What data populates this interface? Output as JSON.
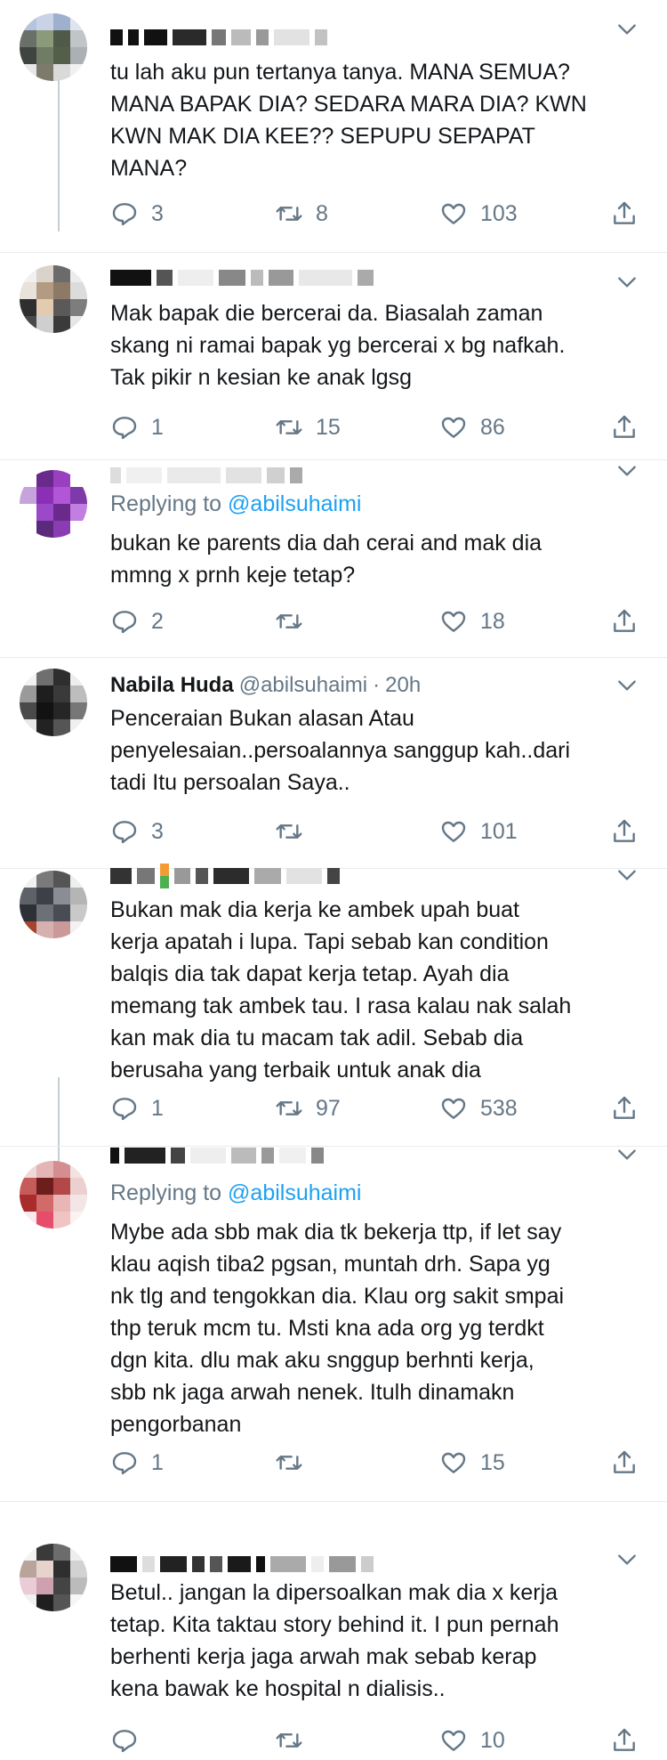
{
  "colors": {
    "text": "#14171a",
    "muted": "#657786",
    "link": "#1da1f2",
    "divider": "#e6ecf0",
    "thread": "#c4cfd6"
  },
  "icons": {
    "reply": "reply-icon",
    "retweet": "retweet-icon",
    "like": "heart-icon",
    "share": "share-icon",
    "more": "chevron-down-icon"
  },
  "tweets": [
    {
      "text": "tu lah aku pun tertanya tanya. MANA SEMUA?\nMANA BAPAK DIA? SEDARA MARA DIA? KWN\nKWN MAK DIA KEE?? SEPUPU SEPAPAT\nMANA?",
      "replies": "3",
      "retweets": "8",
      "likes": "103"
    },
    {
      "text": "Mak bapak die bercerai da. Biasalah zaman\nskang ni ramai bapak yg bercerai x bg nafkah.\nTak pikir n kesian ke anak lgsg",
      "replies": "1",
      "retweets": "15",
      "likes": "86"
    },
    {
      "replying_prefix": "Replying to ",
      "replying_handle": "@abilsuhaimi",
      "text": "bukan ke parents dia dah cerai and mak dia\nmmng x prnh keje tetap?",
      "replies": "2",
      "retweets": "",
      "likes": "18"
    },
    {
      "name": "Nabila Huda",
      "handle": "@abilsuhaimi",
      "sep": "·",
      "time": "20h",
      "text": "Penceraian Bukan alasan Atau\npenyelesaian..persoalannya sanggup kah..dari\ntadi Itu persoalan Saya..",
      "replies": "3",
      "retweets": "",
      "likes": "101"
    },
    {
      "text": "Bukan mak dia kerja ke ambek upah buat\nkerja apatah i lupa. Tapi sebab kan condition\nbalqis dia tak dapat kerja tetap. Ayah dia\nmemang tak ambek tau. I rasa kalau nak salah\nkan mak dia tu macam tak adil. Sebab dia\nberusaha yang terbaik untuk anak dia",
      "replies": "1",
      "retweets": "97",
      "likes": "538"
    },
    {
      "replying_prefix": "Replying to ",
      "replying_handle": "@abilsuhaimi",
      "text": "Mybe ada sbb mak dia tk bekerja ttp, if let say\nklau aqish tiba2 pgsan, muntah drh. Sapa yg\nnk tlg and tengokkan dia. Klau org sakit smpai\nthp teruk mcm tu. Msti kna ada org yg terdkt\ndgn kita. dlu mak aku snggup berhnti kerja,\nsbb nk jaga arwah nenek. Itulh dinamakn\npengorbanan",
      "replies": "1",
      "retweets": "",
      "likes": "15"
    },
    {
      "text": "Betul.. jangan la dipersoalkan mak dia x kerja\ntetap. Kita taktau story behind it. I pun pernah\nberhenti kerja jaga arwah mak sebab kerap\nkena bawak ke hospital n dialisis..",
      "replies": "",
      "retweets": "",
      "likes": "10"
    }
  ]
}
